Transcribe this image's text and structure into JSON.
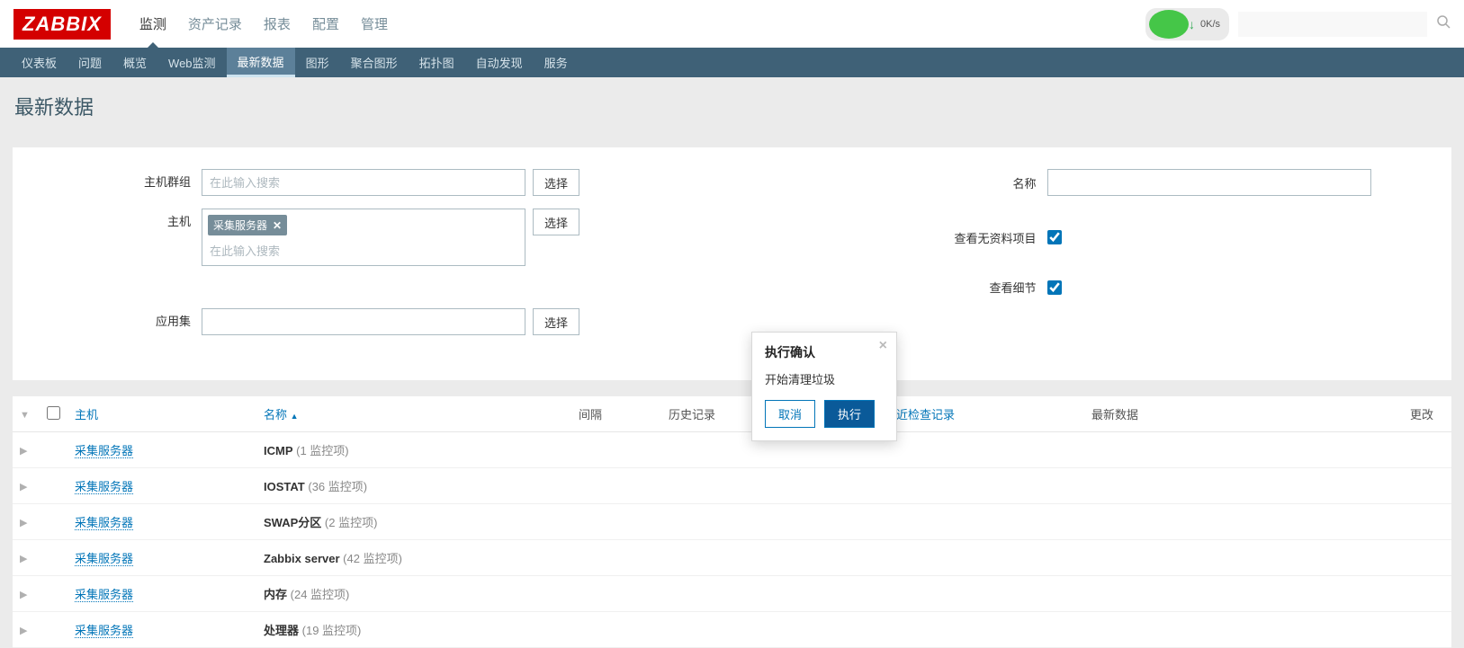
{
  "logo": "ZABBIX",
  "main_nav": [
    "监测",
    "资产记录",
    "报表",
    "配置",
    "管理"
  ],
  "main_nav_active": 0,
  "sub_nav": [
    "仪表板",
    "问题",
    "概览",
    "Web监测",
    "最新数据",
    "图形",
    "聚合图形",
    "拓扑图",
    "自动发现",
    "服务"
  ],
  "sub_nav_active": 4,
  "net_widget": {
    "speed": "0K/s"
  },
  "page_title": "最新数据",
  "filters": {
    "host_group_label": "主机群组",
    "host_group_placeholder": "在此输入搜索",
    "host_label": "主机",
    "host_tag": "采集服务器",
    "host_placeholder": "在此输入搜索",
    "appset_label": "应用集",
    "appset_value": "",
    "select_btn": "选择",
    "name_label": "名称",
    "name_value": "",
    "show_no_data_label": "查看无资料项目",
    "show_no_data_checked": true,
    "show_detail_label": "查看细节",
    "show_detail_checked": true
  },
  "table": {
    "headers": {
      "host": "主机",
      "name": "名称",
      "interval": "间隔",
      "history": "历史记录",
      "last_check": "最近检查记录",
      "latest_data": "最新数据",
      "change": "更改"
    },
    "rows": [
      {
        "host": "采集服务器",
        "app": "ICMP",
        "count": "(1 监控项)"
      },
      {
        "host": "采集服务器",
        "app": "IOSTAT",
        "count": "(36 监控项)"
      },
      {
        "host": "采集服务器",
        "app": "SWAP分区",
        "count": "(2 监控项)"
      },
      {
        "host": "采集服务器",
        "app": "Zabbix server",
        "count": "(42 监控项)"
      },
      {
        "host": "采集服务器",
        "app": "内存",
        "count": "(24 监控项)"
      },
      {
        "host": "采集服务器",
        "app": "处理器",
        "count": "(19 监控项)"
      }
    ]
  },
  "modal": {
    "title": "执行确认",
    "message": "开始清理垃圾",
    "cancel": "取消",
    "execute": "执行"
  }
}
